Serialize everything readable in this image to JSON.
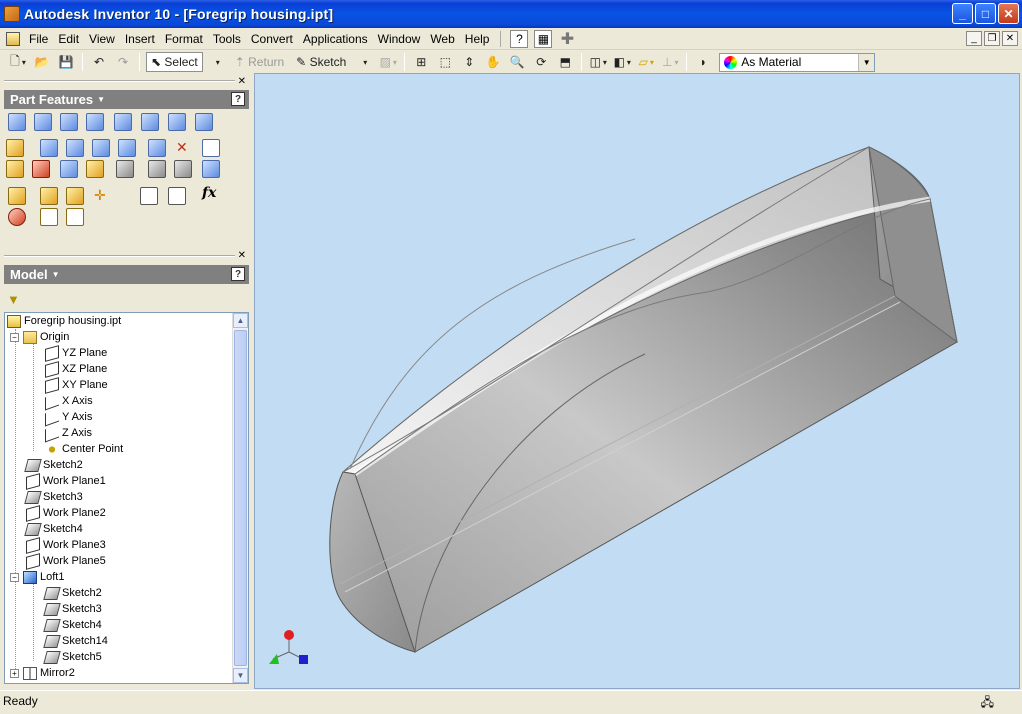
{
  "window": {
    "title": "Autodesk Inventor 10 - [Foregrip housing.ipt]"
  },
  "menu": [
    "File",
    "Edit",
    "View",
    "Insert",
    "Format",
    "Tools",
    "Convert",
    "Applications",
    "Window",
    "Web",
    "Help"
  ],
  "toolbar": {
    "select_label": "Select",
    "return_label": "Return",
    "sketch_label": "Sketch",
    "material_value": "As Material"
  },
  "panels": {
    "features_title": "Part Features",
    "model_title": "Model"
  },
  "tree": {
    "items": [
      {
        "label": "Foregrip housing.ipt",
        "icon": "part-icon"
      },
      {
        "label": "Origin",
        "icon": "folder-icon"
      },
      {
        "label": "YZ Plane",
        "icon": "plane-icon"
      },
      {
        "label": "XZ Plane",
        "icon": "plane-icon"
      },
      {
        "label": "XY Plane",
        "icon": "plane-icon"
      },
      {
        "label": "X Axis",
        "icon": "axis-icon"
      },
      {
        "label": "Y Axis",
        "icon": "axis-icon"
      },
      {
        "label": "Z Axis",
        "icon": "axis-icon"
      },
      {
        "label": "Center Point",
        "icon": "point-icon"
      },
      {
        "label": "Sketch2",
        "icon": "sketch-icon"
      },
      {
        "label": "Work Plane1",
        "icon": "workplane-icon"
      },
      {
        "label": "Sketch3",
        "icon": "sketch-icon"
      },
      {
        "label": "Work Plane2",
        "icon": "workplane-icon"
      },
      {
        "label": "Sketch4",
        "icon": "sketch-icon"
      },
      {
        "label": "Work Plane3",
        "icon": "workplane-icon"
      },
      {
        "label": "Work Plane5",
        "icon": "workplane-icon"
      },
      {
        "label": "Loft1",
        "icon": "loft-icon"
      },
      {
        "label": "Sketch2",
        "icon": "sketch-icon"
      },
      {
        "label": "Sketch3",
        "icon": "sketch-icon"
      },
      {
        "label": "Sketch4",
        "icon": "sketch-icon"
      },
      {
        "label": "Sketch14",
        "icon": "sketch-icon"
      },
      {
        "label": "Sketch5",
        "icon": "sketch-icon"
      },
      {
        "label": "Mirror2",
        "icon": "mirror-icon"
      }
    ]
  },
  "status": {
    "text": "Ready"
  },
  "colors": {
    "viewport_bg": "#C2DDF3",
    "titlebar": "#0854E3",
    "panel_header": "#808080"
  }
}
